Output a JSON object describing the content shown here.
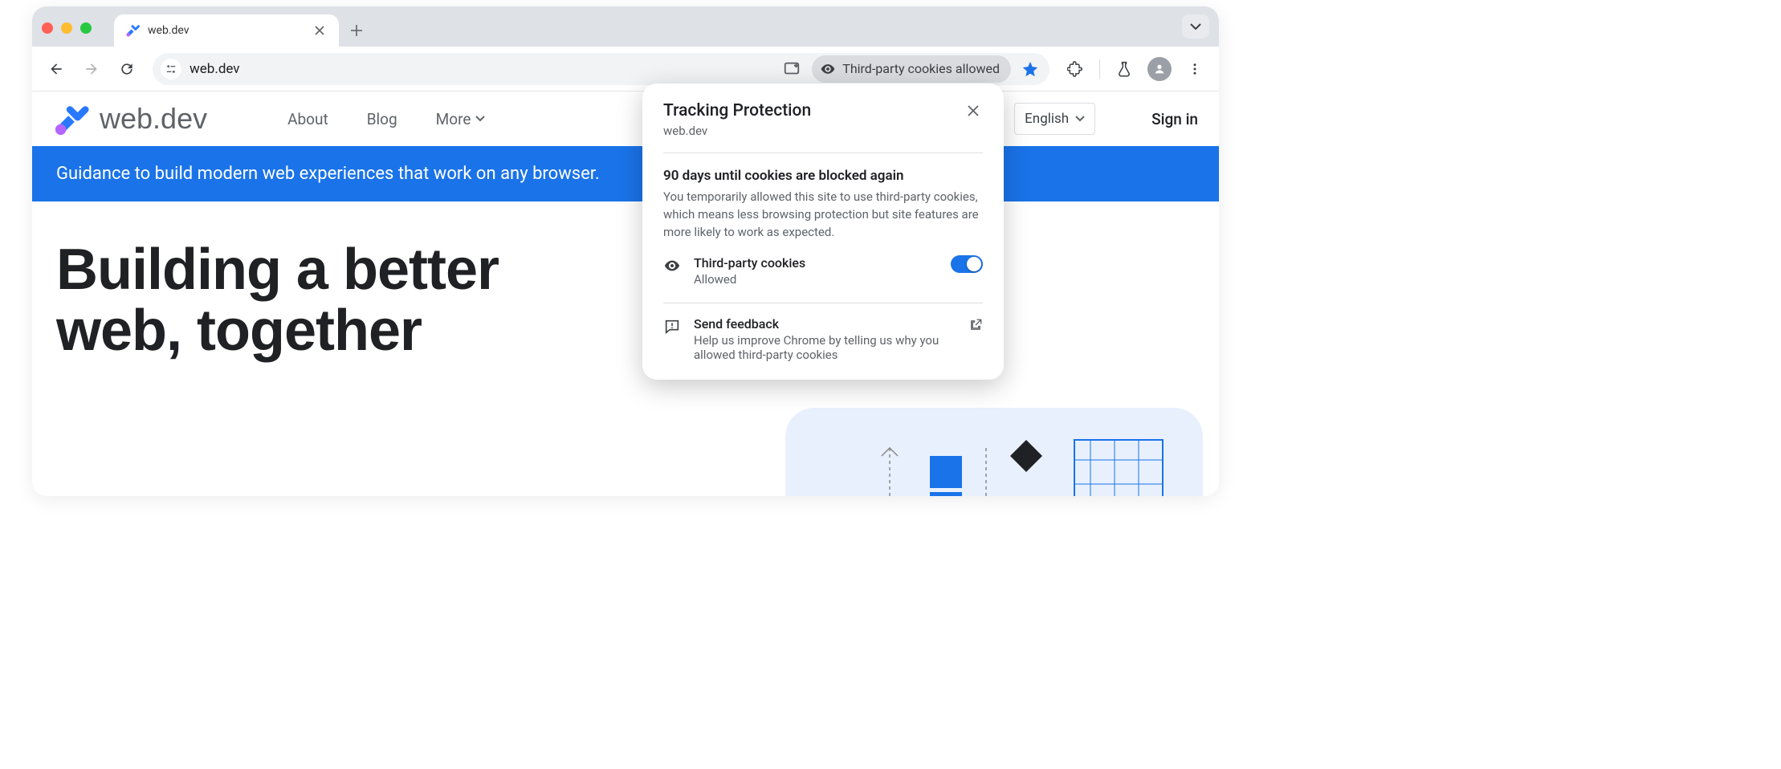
{
  "tab": {
    "title": "web.dev"
  },
  "omnibox": {
    "url": "web.dev"
  },
  "toolbar": {
    "cookies_chip": "Third-party cookies allowed"
  },
  "site": {
    "logo_text": "web.dev",
    "nav": {
      "about": "About",
      "blog": "Blog",
      "more": "More"
    },
    "language": "English",
    "signin": "Sign in",
    "banner": "Guidance to build modern web experiences that work on any browser.",
    "hero_l1": "Building a better",
    "hero_l2": "web, together"
  },
  "tp": {
    "title": "Tracking Protection",
    "site": "web.dev",
    "days_heading": "90 days until cookies are blocked again",
    "days_body": "You temporarily allowed this site to use third-party cookies, which means less browsing protection but site features are more likely to work as expected.",
    "cookie_row_title": "Third-party cookies",
    "cookie_row_status": "Allowed",
    "feedback_title": "Send feedback",
    "feedback_body": "Help us improve Chrome by telling us why you allowed third-party cookies"
  }
}
